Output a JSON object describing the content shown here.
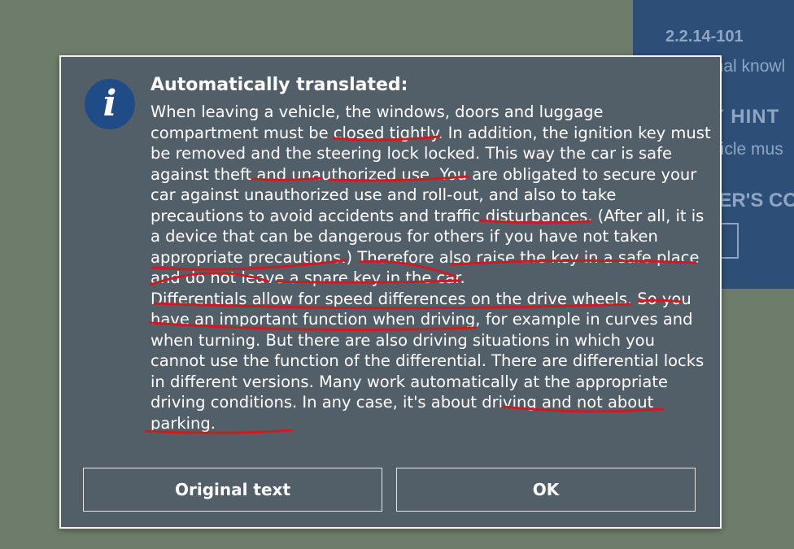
{
  "background_panel": {
    "version": "2.2.14-101",
    "fragment_knowledge": "onal knowl",
    "fragment_hint": "Y HINT",
    "fragment_vehicle": "hicle mus",
    "fragment_other": "HER'S CO"
  },
  "dialog": {
    "title": "Automatically translated:",
    "body": "When leaving a vehicle, the windows, doors and luggage compartment must be closed tightly. In addition, the ignition key must be removed and the steering lock locked. This way the car is safe against theft and unauthorized use. You are obligated to secure your car against unauthorized use and roll-out, and also to take precautions to avoid accidents and traffic disturbances. (After all, it is a device that can be dangerous for others if you have not taken appropriate precautions.) Therefore also raise the key in a safe place and do not leave a spare key in the car.\nDifferentials allow for speed differences on the drive wheels. So you have an important function when driving, for example in curves and when turning. But there are also driving situations in which you cannot use the function of the differential. There are differential locks in different versions. Many work automatically at the appropriate driving conditions. In any case, it's about driving and not about parking.",
    "buttons": {
      "original_label": "Original text",
      "ok_label": "OK"
    }
  },
  "icons": {
    "info": "info-icon"
  },
  "colors": {
    "background": "#6e7d6b",
    "dialog_bg": "#525f69",
    "icon_bg": "#1f4c87",
    "background_panel": "#2c4e77",
    "annotation_red": "#cf1a22"
  }
}
